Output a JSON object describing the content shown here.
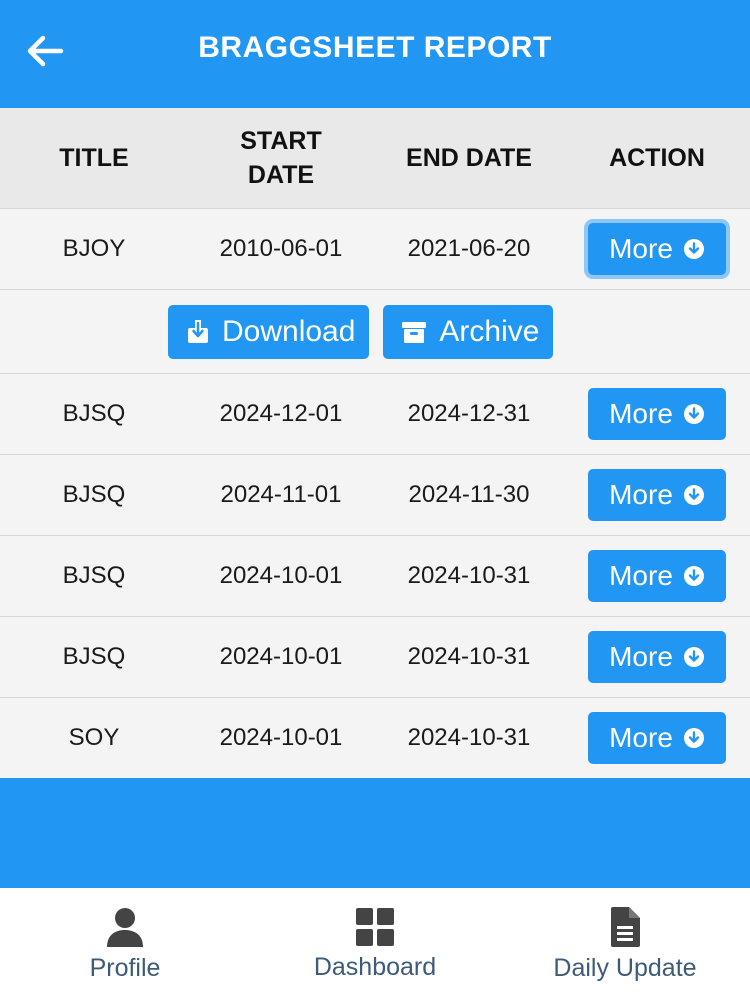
{
  "header": {
    "title": "BRAGGSHEET REPORT",
    "back_icon": "arrow-left-icon"
  },
  "table": {
    "columns": [
      "TITLE",
      "START\nDATE",
      "END DATE",
      "ACTION"
    ],
    "rows": [
      {
        "title": "BJOY",
        "start": "2010-06-01",
        "end": "2021-06-20",
        "action": "More",
        "expanded": true
      },
      {
        "title": "BJSQ",
        "start": "2024-12-01",
        "end": "2024-12-31",
        "action": "More"
      },
      {
        "title": "BJSQ",
        "start": "2024-11-01",
        "end": "2024-11-30",
        "action": "More"
      },
      {
        "title": "BJSQ",
        "start": "2024-10-01",
        "end": "2024-10-31",
        "action": "More"
      },
      {
        "title": "BJSQ",
        "start": "2024-10-01",
        "end": "2024-10-31",
        "action": "More"
      },
      {
        "title": "SOY",
        "start": "2024-10-01",
        "end": "2024-10-31",
        "action": "More"
      }
    ],
    "expanded_actions": {
      "download": "Download",
      "archive": "Archive"
    }
  },
  "bottom_nav": {
    "items": [
      {
        "label": "Profile",
        "icon": "user-icon"
      },
      {
        "label": "Dashboard",
        "icon": "grid-icon"
      },
      {
        "label": "Daily Update",
        "icon": "document-icon"
      }
    ]
  },
  "colors": {
    "primary": "#2196f3",
    "header_row": "#e9e9ea",
    "row_bg": "#f4f4f5",
    "nav_text": "#3e5a7a"
  }
}
